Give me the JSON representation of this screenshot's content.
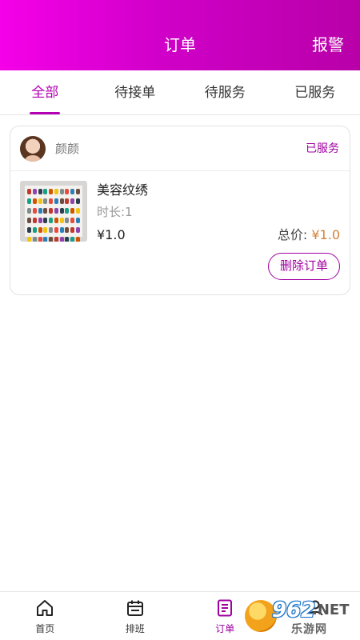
{
  "header": {
    "title": "订单",
    "alarm_label": "报警",
    "gradient_colors": [
      "#f500e8",
      "#b800a8"
    ]
  },
  "tabs": [
    {
      "label": "全部",
      "active": true
    },
    {
      "label": "待接单",
      "active": false
    },
    {
      "label": "待服务",
      "active": false
    },
    {
      "label": "已服务",
      "active": false
    }
  ],
  "order": {
    "user_name": "颜颜",
    "status": "已服务",
    "service_name": "美容纹绣",
    "duration": "时长:1",
    "price": "¥1.0",
    "total_label": "总价: ",
    "total_value": "¥1.0",
    "delete_label": "删除订单"
  },
  "bottom_nav": [
    {
      "label": "首页",
      "icon": "home-icon",
      "active": false
    },
    {
      "label": "排班",
      "icon": "calendar-icon",
      "active": false
    },
    {
      "label": "订单",
      "icon": "order-list-icon",
      "active": true
    },
    {
      "label": "",
      "icon": "user-icon",
      "active": false
    }
  ],
  "watermark": {
    "number": "962",
    "net": ".NET",
    "text": "乐游网"
  },
  "colors": {
    "accent": "#a000a0",
    "price": "#d2813a"
  }
}
